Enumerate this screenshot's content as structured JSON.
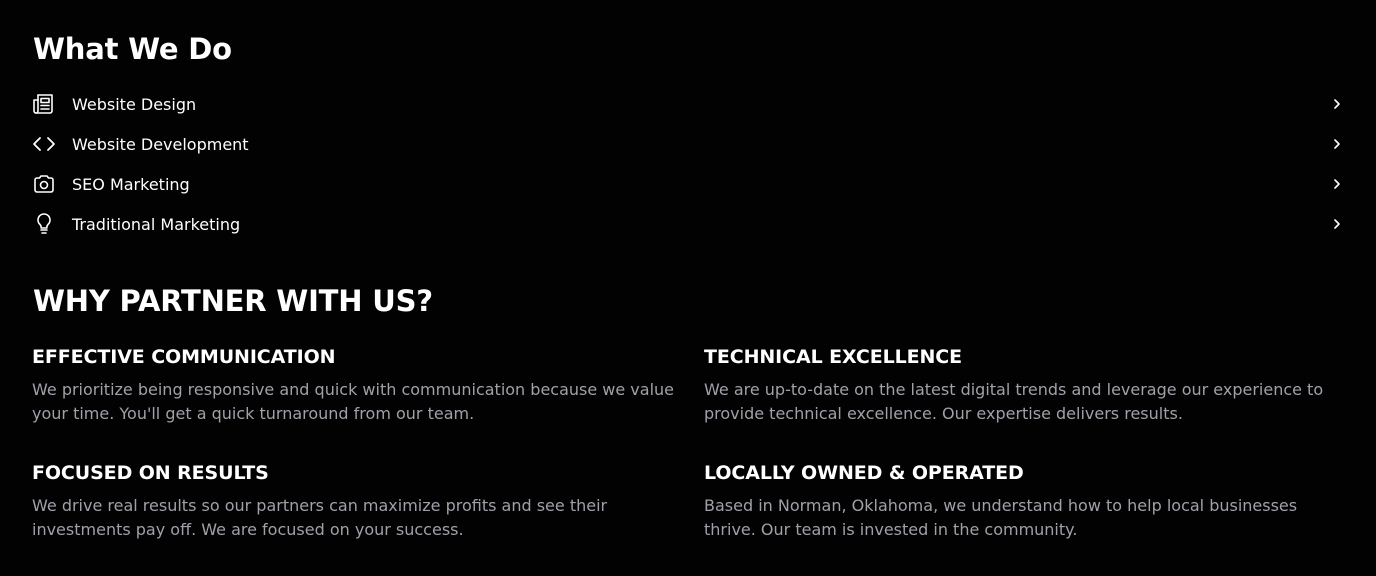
{
  "services": {
    "title": "What We Do",
    "items": [
      {
        "label": "Website Design",
        "icon": "newspaper-icon"
      },
      {
        "label": "Website Development",
        "icon": "code-icon"
      },
      {
        "label": "SEO Marketing",
        "icon": "camera-icon"
      },
      {
        "label": "Traditional Marketing",
        "icon": "lightbulb-icon"
      }
    ]
  },
  "partner": {
    "title": "WHY PARTNER WITH US?",
    "features": [
      {
        "heading": "EFFECTIVE COMMUNICATION",
        "body": "We prioritize being responsive and quick with communication because we value your time. You'll get a quick turnaround from our team."
      },
      {
        "heading": "TECHNICAL EXCELLENCE",
        "body": "We are up-to-date on the latest digital trends and leverage our experience to provide technical excellence. Our expertise delivers results."
      },
      {
        "heading": "FOCUSED ON RESULTS",
        "body": "We drive real results so our partners can maximize profits and see their investments pay off. We are focused on your success."
      },
      {
        "heading": "LOCALLY OWNED & OPERATED",
        "body": "Based in Norman, Oklahoma, we understand how to help local businesses thrive. Our team is invested in the community."
      }
    ]
  },
  "colors": {
    "background": "#030203",
    "text": "#ffffff",
    "muted_text": "#a0a0a8"
  }
}
